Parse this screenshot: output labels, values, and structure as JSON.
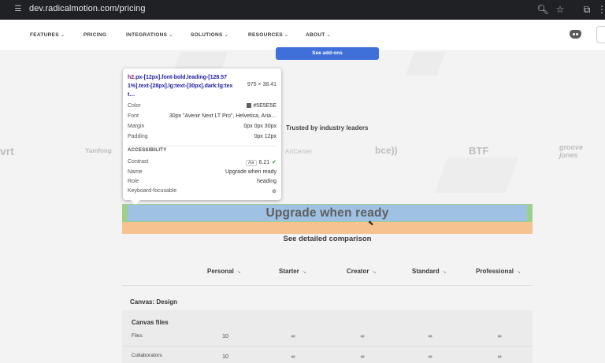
{
  "browser": {
    "url": "dev.radicalmotion.com/pricing",
    "icons": {
      "site_info": "tune-icon",
      "zoom": "zoom-icon",
      "bookmark": "star-icon",
      "extensions": "puzzle-icon"
    }
  },
  "nav": {
    "items": [
      {
        "label": "FEATURES",
        "dropdown": true
      },
      {
        "label": "PRICING",
        "dropdown": false
      },
      {
        "label": "INTEGRATIONS",
        "dropdown": true
      },
      {
        "label": "SOLUTIONS",
        "dropdown": true
      },
      {
        "label": "RESOURCES",
        "dropdown": true
      },
      {
        "label": "ABOUT",
        "dropdown": true
      }
    ],
    "icons": {
      "discord": "discord-icon",
      "menu": "hamburger-icon"
    }
  },
  "hero": {
    "addons_button": "See add-ons"
  },
  "trusted": {
    "heading": "Trusted by industry leaders",
    "logos": [
      "vrt",
      "Yamfong",
      "ArtCenter",
      "bce))",
      "BTF",
      "groove jones"
    ]
  },
  "highlighted": {
    "heading": "Upgrade when ready",
    "subheading": "See detailed comparison"
  },
  "devtools_tooltip": {
    "selector_tag": "h2",
    "selector_classes": ".px-[12px].font-bold.leading-[128.571%].text-[28px].lg:text-[30px].dark:lg:text…",
    "dimensions": "975 × 38.41",
    "color_label": "Color",
    "color_value": "#5E5E5E",
    "font_label": "Font",
    "font_value": "30px \"Avenir Next LT Pro\", Helvetica, Aria…",
    "margin_label": "Margin",
    "margin_value": "0px 0px 30px",
    "padding_label": "Padding",
    "padding_value": "0px 12px",
    "accessibility_label": "ACCESSIBILITY",
    "contrast_label": "Contrast",
    "contrast_badge": "Aa",
    "contrast_value": "6.21",
    "name_label": "Name",
    "name_value": "Upgrade when ready",
    "role_label": "Role",
    "role_value": "heading",
    "keyboard_label": "Keyboard-focusable",
    "icons": {
      "contrast_ok": "check-circle-icon",
      "not_focusable": "no-entry-icon"
    }
  },
  "comparison": {
    "plans": [
      "Personal",
      "Starter",
      "Creator",
      "Standard",
      "Professional"
    ],
    "section": "Canvas: Design",
    "group": "Canvas files",
    "rows": [
      {
        "label": "Files",
        "values": [
          "10",
          "∞",
          "∞",
          "∞",
          "∞"
        ]
      },
      {
        "label": "Collaborators",
        "values": [
          "10",
          "∞",
          "∞",
          "∞",
          "∞"
        ]
      }
    ]
  },
  "colors": {
    "accent": "#3f6fd8",
    "heading_text": "#5E5E5E",
    "highlight_content": "#9fc1e3",
    "highlight_padding": "#9fcf8a",
    "highlight_margin": "#f6c28f"
  }
}
